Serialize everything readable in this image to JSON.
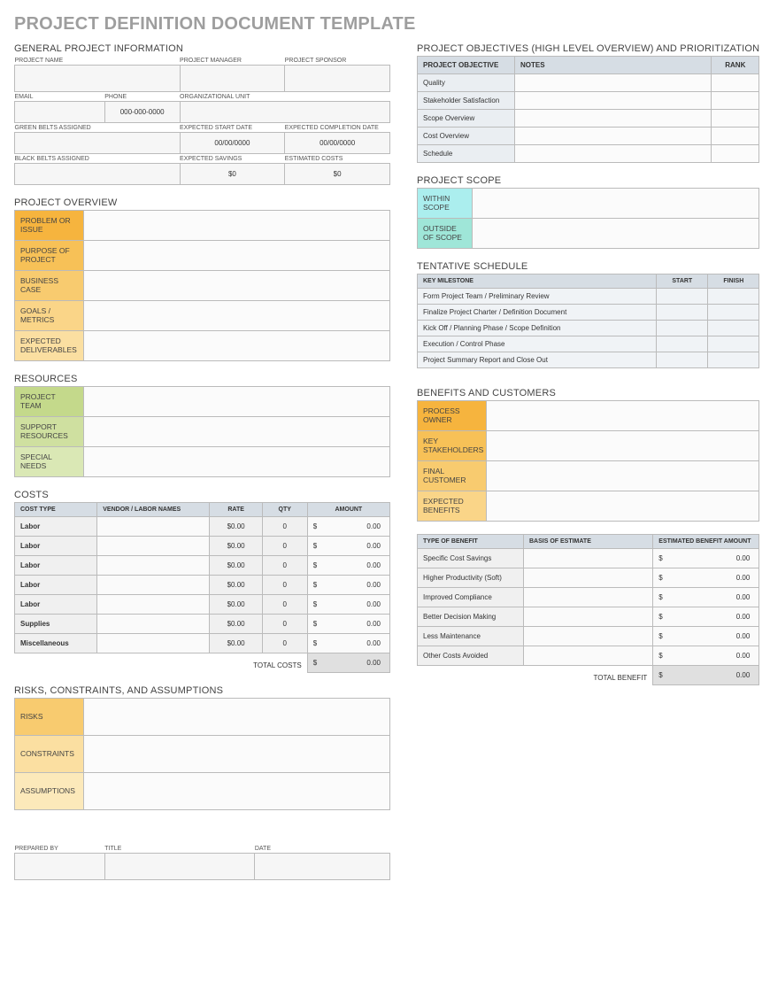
{
  "page_title": "PROJECT DEFINITION DOCUMENT TEMPLATE",
  "left": {
    "general": {
      "title": "GENERAL PROJECT INFORMATION",
      "project_name_lbl": "PROJECT NAME",
      "project_manager_lbl": "PROJECT MANAGER",
      "project_sponsor_lbl": "PROJECT SPONSOR",
      "email_lbl": "EMAIL",
      "phone_lbl": "PHONE",
      "org_unit_lbl": "ORGANIZATIONAL UNIT",
      "phone_val": "000-000-0000",
      "green_belts_lbl": "GREEN BELTS ASSIGNED",
      "start_lbl": "EXPECTED START DATE",
      "end_lbl": "EXPECTED COMPLETION DATE",
      "start_val": "00/00/0000",
      "end_val": "00/00/0000",
      "black_belts_lbl": "BLACK BELTS ASSIGNED",
      "savings_lbl": "EXPECTED SAVINGS",
      "costs_lbl": "ESTIMATED COSTS",
      "savings_val": "$0",
      "costs_val": "$0"
    },
    "overview": {
      "title": "PROJECT OVERVIEW",
      "rows": [
        "PROBLEM OR ISSUE",
        "PURPOSE OF PROJECT",
        "BUSINESS CASE",
        "GOALS / METRICS",
        "EXPECTED DELIVERABLES"
      ]
    },
    "resources": {
      "title": "RESOURCES",
      "rows": [
        "PROJECT TEAM",
        "SUPPORT RESOURCES",
        "SPECIAL NEEDS"
      ]
    },
    "costs": {
      "title": "COSTS",
      "headers": [
        "COST TYPE",
        "VENDOR / LABOR NAMES",
        "RATE",
        "QTY",
        "AMOUNT"
      ],
      "rows": [
        {
          "type": "Labor",
          "rate": "$0.00",
          "qty": "0",
          "amt": "0.00"
        },
        {
          "type": "Labor",
          "rate": "$0.00",
          "qty": "0",
          "amt": "0.00"
        },
        {
          "type": "Labor",
          "rate": "$0.00",
          "qty": "0",
          "amt": "0.00"
        },
        {
          "type": "Labor",
          "rate": "$0.00",
          "qty": "0",
          "amt": "0.00"
        },
        {
          "type": "Labor",
          "rate": "$0.00",
          "qty": "0",
          "amt": "0.00"
        },
        {
          "type": "Supplies",
          "rate": "$0.00",
          "qty": "0",
          "amt": "0.00"
        },
        {
          "type": "Miscellaneous",
          "rate": "$0.00",
          "qty": "0",
          "amt": "0.00"
        }
      ],
      "total_lbl": "TOTAL COSTS",
      "total_val": "0.00"
    },
    "risks": {
      "title": "RISKS, CONSTRAINTS, AND ASSUMPTIONS",
      "rows": [
        "RISKS",
        "CONSTRAINTS",
        "ASSUMPTIONS"
      ]
    },
    "sign": {
      "prepared_lbl": "PREPARED BY",
      "title_lbl": "TITLE",
      "date_lbl": "DATE"
    }
  },
  "right": {
    "objectives": {
      "title": "PROJECT OBJECTIVES (HIGH LEVEL OVERVIEW) AND PRIORITIZATION",
      "headers": [
        "PROJECT OBJECTIVE",
        "NOTES",
        "RANK"
      ],
      "rows": [
        "Quality",
        "Stakeholder Satisfaction",
        "Scope Overview",
        "Cost Overview",
        "Schedule"
      ]
    },
    "scope": {
      "title": "PROJECT SCOPE",
      "rows": [
        "WITHIN SCOPE",
        "OUTSIDE OF SCOPE"
      ]
    },
    "schedule": {
      "title": "TENTATIVE SCHEDULE",
      "headers": [
        "KEY MILESTONE",
        "START",
        "FINISH"
      ],
      "rows": [
        "Form Project Team / Preliminary Review",
        "Finalize Project Charter / Definition Document",
        "Kick Off / Planning Phase / Scope Definition",
        "Execution / Control Phase",
        "Project Summary Report and Close Out"
      ]
    },
    "benefits": {
      "title": "BENEFITS AND CUSTOMERS",
      "rows": [
        "PROCESS OWNER",
        "KEY STAKEHOLDERS",
        "FINAL CUSTOMER",
        "EXPECTED BENEFITS"
      ]
    },
    "btable": {
      "headers": [
        "TYPE OF BENEFIT",
        "BASIS OF ESTIMATE",
        "ESTIMATED BENEFIT AMOUNT"
      ],
      "rows": [
        {
          "type": "Specific Cost Savings",
          "amt": "0.00"
        },
        {
          "type": "Higher Productivity (Soft)",
          "amt": "0.00"
        },
        {
          "type": "Improved Compliance",
          "amt": "0.00"
        },
        {
          "type": "Better Decision Making",
          "amt": "0.00"
        },
        {
          "type": "Less Maintenance",
          "amt": "0.00"
        },
        {
          "type": "Other Costs Avoided",
          "amt": "0.00"
        }
      ],
      "total_lbl": "TOTAL BENEFIT",
      "total_val": "0.00"
    }
  },
  "dollar": "$"
}
